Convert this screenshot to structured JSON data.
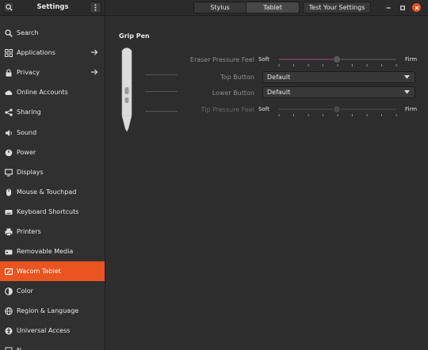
{
  "header": {
    "title": "Settings",
    "tabs": [
      {
        "label": "Stylus"
      },
      {
        "label": "Tablet"
      }
    ],
    "test_button": "Test Your Settings",
    "accent": "#e95420"
  },
  "sidebar": {
    "items": [
      {
        "label": "Search",
        "icon": "search-icon"
      },
      {
        "label": "Applications",
        "icon": "applications-icon",
        "arrow": true
      },
      {
        "label": "Privacy",
        "icon": "privacy-icon",
        "arrow": true
      },
      {
        "label": "Online Accounts",
        "icon": "cloud-icon"
      },
      {
        "label": "Sharing",
        "icon": "share-icon"
      },
      {
        "label": "Sound",
        "icon": "sound-icon"
      },
      {
        "label": "Power",
        "icon": "power-icon"
      },
      {
        "label": "Displays",
        "icon": "display-icon"
      },
      {
        "label": "Mouse & Touchpad",
        "icon": "mouse-icon"
      },
      {
        "label": "Keyboard Shortcuts",
        "icon": "keyboard-icon"
      },
      {
        "label": "Printers",
        "icon": "printer-icon"
      },
      {
        "label": "Removable Media",
        "icon": "removable-media-icon"
      },
      {
        "label": "Wacom Tablet",
        "icon": "tablet-icon",
        "active": true
      },
      {
        "label": "Color",
        "icon": "color-icon"
      },
      {
        "label": "Region & Language",
        "icon": "globe-icon"
      },
      {
        "label": "Universal Access",
        "icon": "accessibility-icon"
      },
      {
        "label": "N",
        "icon": "network-icon"
      }
    ]
  },
  "stylus": {
    "name": "Grip Pen",
    "eraser_pressure": {
      "label": "Eraser Pressure Feel",
      "min_label": "Soft",
      "max_label": "Firm",
      "value": 0.5,
      "enabled": true
    },
    "top_button": {
      "label": "Top Button",
      "value": "Default"
    },
    "lower_button": {
      "label": "Lower Button",
      "value": "Default"
    },
    "tip_pressure": {
      "label": "Tip Pressure Feel",
      "min_label": "Soft",
      "max_label": "Firm",
      "value": 0.5,
      "enabled": false
    }
  }
}
